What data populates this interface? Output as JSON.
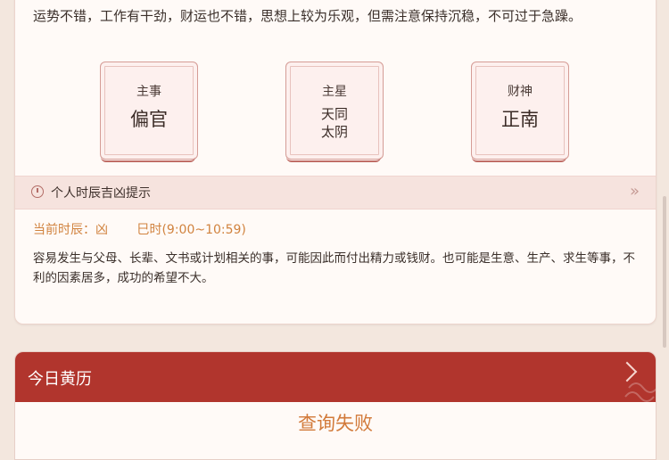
{
  "fortune_card": {
    "intro": "运势不错，工作有干劲，财运也不错，思想上较为乐观，但需注意保持沉稳，不可过于急躁。",
    "boxes": [
      {
        "label": "主事",
        "value": "偏官"
      },
      {
        "label": "主星",
        "value_line1": "天同",
        "value_line2": "太阴"
      },
      {
        "label": "财神",
        "value": "正南"
      }
    ],
    "hint": {
      "title": "个人时辰吉凶提示",
      "icon": "clock-icon"
    },
    "current_time": {
      "label": "当前时辰：凶",
      "period": "巳时(9:00~10:59)"
    },
    "description": "容易发生与父母、长辈、文书或计划相关的事，可能因此而付出精力或钱财。也可能是生意、生产、求生等事，不利的因素居多，成功的希望不大。"
  },
  "almanac_card": {
    "title": "今日黄历",
    "status": "查询失败"
  },
  "colors": {
    "accent_red": "#b1352d",
    "orange": "#d27a3a",
    "background": "#f3e7de"
  }
}
